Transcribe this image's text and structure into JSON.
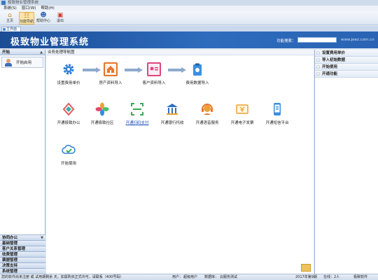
{
  "window": {
    "title": "极致物业管理系统"
  },
  "menubar": {
    "items": [
      "系统(S)",
      "窗口(W)",
      "帮助(H)"
    ]
  },
  "toolbar": {
    "buttons": [
      {
        "label": "主页",
        "icon": "home-icon"
      },
      {
        "label": "功能导航",
        "icon": "nav-icon"
      },
      {
        "label": "帮助中心",
        "icon": "help-center-icon"
      },
      {
        "label": "退出",
        "icon": "exit-icon"
      }
    ]
  },
  "doc_tab": {
    "label": "主界面"
  },
  "banner": {
    "title": "极致物业管理系统",
    "search_label": "功能搜索：",
    "search_value": "",
    "url": "www.jeez.com.cn"
  },
  "sidebar": {
    "header": "开始",
    "items": [
      {
        "label": "开始启用"
      }
    ],
    "groups": [
      "协同办公",
      "基础管理",
      "客户关系管理",
      "收费管理",
      "票据管理",
      "决策支持",
      "系统管理"
    ]
  },
  "main": {
    "title": "业务处理导航图",
    "flow": [
      {
        "label": "设置费用单价",
        "icon": "gear-icon"
      },
      {
        "label": "房产资料导入",
        "icon": "house-import-icon"
      },
      {
        "label": "客户资料导入",
        "icon": "customer-card-icon"
      },
      {
        "label": "费用数据导入",
        "icon": "fee-clipboard-icon"
      }
    ],
    "services": [
      {
        "label": "开通极致办公",
        "icon": "office-icon"
      },
      {
        "label": "开通极致社区",
        "icon": "community-icon"
      },
      {
        "label": "开通扫码支付",
        "icon": "scan-pay-icon"
      },
      {
        "label": "开通银行托收",
        "icon": "bank-icon"
      },
      {
        "label": "开通语音服务",
        "icon": "voice-service-icon"
      },
      {
        "label": "开通电子发票",
        "icon": "e-invoice-icon"
      },
      {
        "label": "开通短信平台",
        "icon": "sms-platform-icon"
      }
    ],
    "extra": {
      "label": "开始使用",
      "icon": "cloud-check-icon"
    }
  },
  "right_panel": {
    "items": [
      "设置费用单价",
      "导入初始数据",
      "开始使用",
      "开通功能"
    ]
  },
  "statusbar": {
    "left": "您的软件尚未注册 或 试用期剩余 天，如需购买正式许可，请联系（400号码）",
    "user_label": "用户：",
    "user": "超级用户",
    "db_label": "数据库：",
    "db": "云服务测试",
    "period": "2017年第9期",
    "online": "在线：2人",
    "brand": "极致软件"
  }
}
